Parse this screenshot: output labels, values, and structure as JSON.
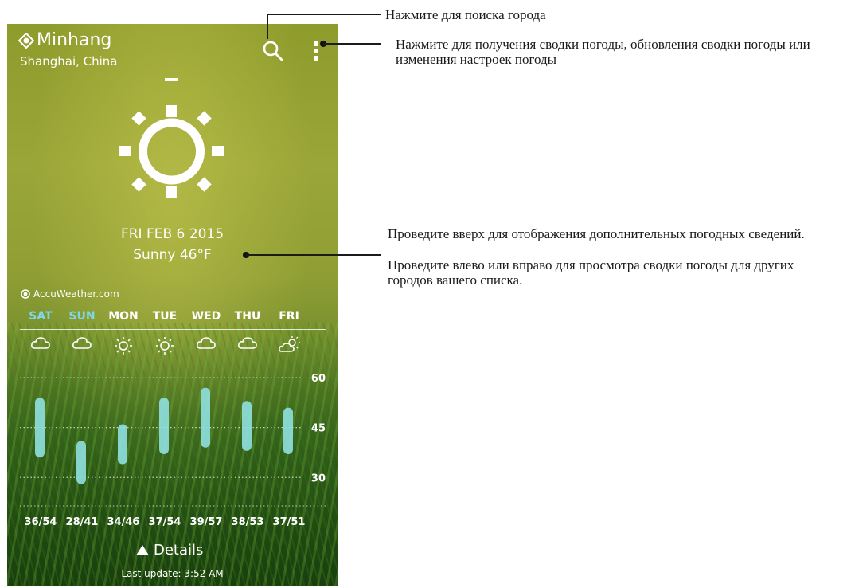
{
  "location": {
    "city": "Minhang",
    "region": "Shanghai, China"
  },
  "current": {
    "date": "FRI FEB 6 2015",
    "condition": "Sunny 46°F"
  },
  "provider": "AccuWeather.com",
  "forecast": [
    {
      "day": "SAT",
      "icon": "cloud-icon",
      "range": "36/54",
      "highlight": true
    },
    {
      "day": "SUN",
      "icon": "cloud-icon",
      "range": "28/41",
      "highlight": true
    },
    {
      "day": "MON",
      "icon": "sun-icon",
      "range": "34/46",
      "highlight": false
    },
    {
      "day": "TUE",
      "icon": "sun-icon",
      "range": "37/54",
      "highlight": false
    },
    {
      "day": "WED",
      "icon": "cloud-icon",
      "range": "39/57",
      "highlight": false
    },
    {
      "day": "THU",
      "icon": "cloud-icon",
      "range": "38/53",
      "highlight": false
    },
    {
      "day": "FRI",
      "icon": "partly-sunny-icon",
      "range": "37/51",
      "highlight": false
    }
  ],
  "chart_data": {
    "type": "bar",
    "categories": [
      "SAT",
      "SUN",
      "MON",
      "TUE",
      "WED",
      "THU",
      "FRI"
    ],
    "series": [
      {
        "low": [
          36,
          28,
          34,
          37,
          39,
          38,
          37
        ],
        "high": [
          54,
          41,
          46,
          54,
          57,
          53,
          51
        ]
      }
    ],
    "yticks": [
      "60",
      "45",
      "30"
    ],
    "ylim": [
      20,
      66
    ],
    "bar_color": "#8fe0e0"
  },
  "footer": {
    "details_label": "Details",
    "last_update": "Last update: 3:52 AM"
  },
  "annotations": {
    "search": "Нажмите для поиска города",
    "menu": "Нажмите для получения сводки погоды, обновления сводки погоды или изменения настроек погоды",
    "swipe_line1": "Проведите вверх для отображения дополнительных погодных сведений.",
    "swipe_line2": "Проведите влево или вправо для просмотра сводки погоды для других городов вашего списка."
  },
  "colors": {
    "highlight_day": "#7fd6e6",
    "bar": "#8fe0e0"
  }
}
